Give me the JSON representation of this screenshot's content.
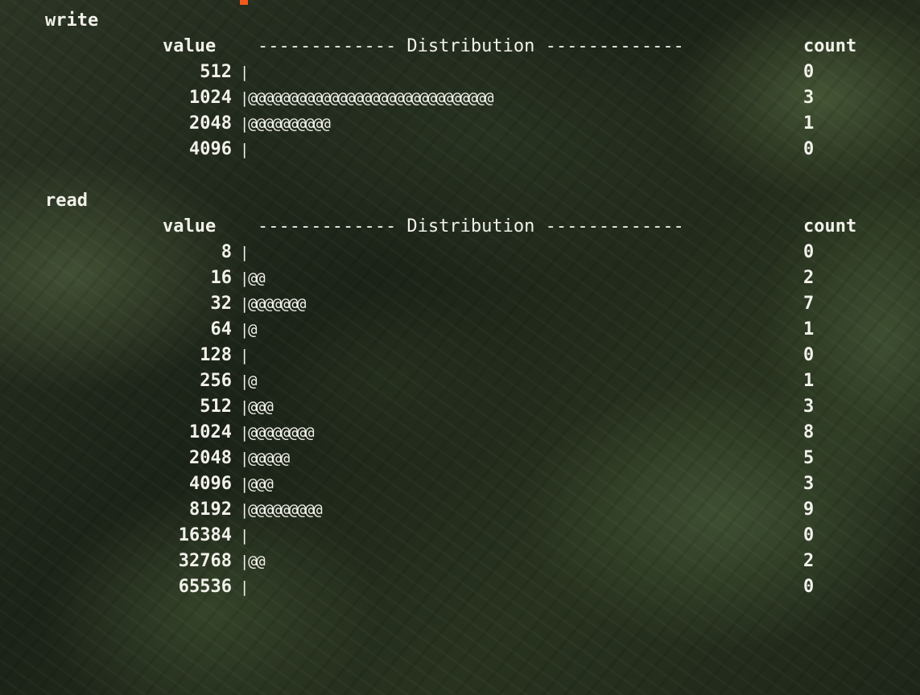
{
  "sections": [
    {
      "title": "write",
      "header": {
        "value": "value",
        "distribution": "------------- Distribution -------------",
        "count": "count"
      },
      "rows": [
        {
          "value": "512",
          "bar": "|",
          "count": "0"
        },
        {
          "value": "1024",
          "bar": "|@@@@@@@@@@@@@@@@@@@@@@@@@@@@@@",
          "count": "3"
        },
        {
          "value": "2048",
          "bar": "|@@@@@@@@@@",
          "count": "1"
        },
        {
          "value": "4096",
          "bar": "|",
          "count": "0"
        }
      ]
    },
    {
      "title": "read",
      "header": {
        "value": "value",
        "distribution": "------------- Distribution -------------",
        "count": "count"
      },
      "rows": [
        {
          "value": "8",
          "bar": "|",
          "count": "0"
        },
        {
          "value": "16",
          "bar": "|@@",
          "count": "2"
        },
        {
          "value": "32",
          "bar": "|@@@@@@@",
          "count": "7"
        },
        {
          "value": "64",
          "bar": "|@",
          "count": "1"
        },
        {
          "value": "128",
          "bar": "|",
          "count": "0"
        },
        {
          "value": "256",
          "bar": "|@",
          "count": "1"
        },
        {
          "value": "512",
          "bar": "|@@@",
          "count": "3"
        },
        {
          "value": "1024",
          "bar": "|@@@@@@@@",
          "count": "8"
        },
        {
          "value": "2048",
          "bar": "|@@@@@",
          "count": "5"
        },
        {
          "value": "4096",
          "bar": "|@@@",
          "count": "3"
        },
        {
          "value": "8192",
          "bar": "|@@@@@@@@@",
          "count": "9"
        },
        {
          "value": "16384",
          "bar": "|",
          "count": "0"
        },
        {
          "value": "32768",
          "bar": "|@@",
          "count": "2"
        },
        {
          "value": "65536",
          "bar": "|",
          "count": "0"
        }
      ]
    }
  ],
  "colors": {
    "text": "#f1f1ea",
    "cursor": "#f05a1e",
    "background": "#1b2217"
  }
}
